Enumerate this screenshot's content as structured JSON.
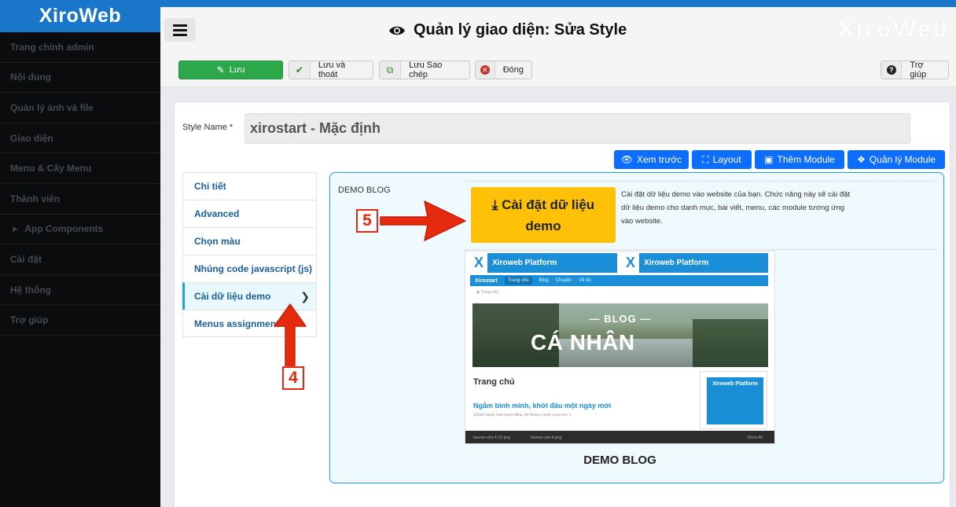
{
  "sidebar": {
    "brand": "XiroWeb",
    "items": [
      {
        "label": "Trang chính admin"
      },
      {
        "label": "Nội dung"
      },
      {
        "label": "Quản lý ảnh và file"
      },
      {
        "label": "Giao diện"
      },
      {
        "label": "Menu & Cây Menu"
      },
      {
        "label": "Thành viên"
      },
      {
        "label": "App Components",
        "icon": "paper-plane-icon"
      },
      {
        "label": "Cài đặt"
      },
      {
        "label": "Hệ thống"
      },
      {
        "label": "Trợ giúp"
      }
    ]
  },
  "header": {
    "title": "Quản lý giao diện: Sửa Style",
    "watermark": "XiroWeb"
  },
  "toolbar": {
    "save": "Lưu",
    "save_close": "Lưu và thoát",
    "save_copy": "Lưu Sao chép",
    "close": "Đóng",
    "help": "Trợ giúp"
  },
  "form": {
    "style_name_label": "Style Name *",
    "style_name_value": "xirostart - Mặc định"
  },
  "actions": {
    "preview": "Xem trước",
    "layout": "Layout",
    "add_module": "Thêm Module",
    "manage_module": "Quản lý Module"
  },
  "tabs": [
    {
      "label": "Chi tiết"
    },
    {
      "label": "Advanced"
    },
    {
      "label": "Chọn màu"
    },
    {
      "label": "Nhúng code javascript (js)"
    },
    {
      "label": "Cài dữ liệu demo",
      "active": true
    },
    {
      "label": "Menus assignment"
    }
  ],
  "demo": {
    "section_label": "DEMO BLOG",
    "install_btn_line1": "Cài đặt dữ liệu",
    "install_btn_line2": "demo",
    "install_desc": "Cài đặt dữ liệu demo vào website của bạn. Chức năng này sẽ cài đặt dữ liệu demo cho danh mục, bài viết, menu, các module tương ứng vào website.",
    "caption": "DEMO BLOG"
  },
  "thumbnail": {
    "banner_text": "Xiroweb Platform",
    "nav": [
      "Xirostart",
      "Trang chủ",
      "Blog",
      "Chuyên",
      "Về tôi"
    ],
    "breadcrumb": "Trang chủ",
    "hero_line1": "BLOG",
    "hero_line2": "CÁ NHÂN",
    "page_heading": "Trang chủ",
    "post_title": "Ngắm bình minh, khởi đầu một ngày mới",
    "post_meta": "Hồi bởi Super User   Được đăng: 08 Tháng 4 2021   Lượt xem: 1",
    "side_banner": "Xiroweb Platform",
    "footer_tabs": [
      "banner-xiro-4 (1).png",
      "banner-xiro-4.png",
      "Show All"
    ]
  },
  "annotations": {
    "step4": "4",
    "step5": "5",
    "color": "#e52a10"
  },
  "colors": {
    "primary": "#1a76c9",
    "success": "#2ca84a",
    "info_button": "#0d6efd",
    "warning": "#ffc107",
    "tab_active_accent": "#1aa9c8"
  }
}
